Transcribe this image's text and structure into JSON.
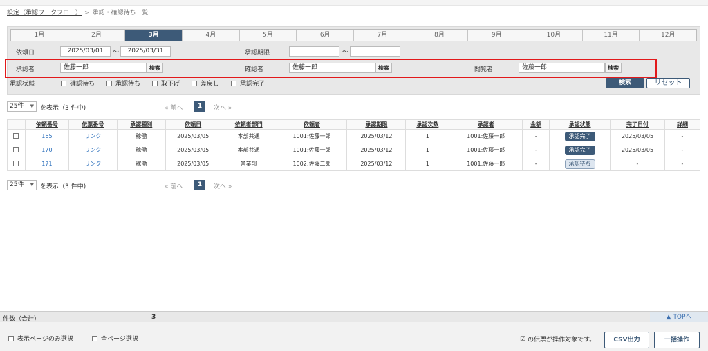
{
  "breadcrumb": {
    "root": "設定（承認ワークフロー）",
    "sep": ">",
    "current": "承認・確認待ち一覧"
  },
  "months": [
    "1月",
    "2月",
    "3月",
    "4月",
    "5月",
    "6月",
    "7月",
    "8月",
    "9月",
    "10月",
    "11月",
    "12月"
  ],
  "active_month": "3月",
  "filters": {
    "request_date_label": "依頼日",
    "request_date_from": "2025/03/01",
    "request_date_to": "2025/03/31",
    "tilde": "〜",
    "deadline_label": "承認期限",
    "deadline_from": "",
    "deadline_to": "",
    "approver_label": "承認者",
    "approver_value": "佐藤一郎",
    "confirmer_label": "確認者",
    "confirmer_value": "佐藤一郎",
    "viewer_label": "閲覧者",
    "viewer_value": "佐藤一郎",
    "lookup_label": "検索",
    "status_label": "承認状態",
    "status_options": [
      "確認待ち",
      "承認待ち",
      "取下げ",
      "差戻し",
      "承認完了"
    ],
    "search_button": "検索",
    "reset_button": "リセット"
  },
  "pager": {
    "per_page": "25件",
    "count_text": "を表示（3 件中)",
    "prev": "« 前へ",
    "page": "1",
    "next": "次へ »"
  },
  "table": {
    "headers": [
      "",
      "依頼番号",
      "伝票番号",
      "承認種別",
      "依頼日",
      "依頼者部門",
      "依頼者",
      "承認期限",
      "承認次数",
      "承認者",
      "金額",
      "承認状態",
      "完了日付",
      "詳細"
    ],
    "rows": [
      {
        "no": "165",
        "slip": "リンク",
        "type": "稼働",
        "date": "2025/03/05",
        "dept": "本部共通",
        "requester": "1001:佐藤一郎",
        "deadline": "2025/03/12",
        "level": "1",
        "approver": "1001:佐藤一郎",
        "amount": "-",
        "status": "承認完了",
        "done": "2025/03/05",
        "detail": "-"
      },
      {
        "no": "170",
        "slip": "リンク",
        "type": "稼働",
        "date": "2025/03/05",
        "dept": "本部共通",
        "requester": "1001:佐藤一郎",
        "deadline": "2025/03/12",
        "level": "1",
        "approver": "1001:佐藤一郎",
        "amount": "-",
        "status": "承認完了",
        "done": "2025/03/05",
        "detail": "-"
      },
      {
        "no": "171",
        "slip": "リンク",
        "type": "稼働",
        "date": "2025/03/05",
        "dept": "営業部",
        "requester": "1002:佐藤二郎",
        "deadline": "2025/03/12",
        "level": "1",
        "approver": "1001:佐藤一郎",
        "amount": "-",
        "status": "承認待ち",
        "done": "-",
        "detail": "-"
      }
    ]
  },
  "total": {
    "label": "件数（合計）",
    "value": "3",
    "top_link": "▲ TOPへ"
  },
  "footer": {
    "select_page": "表示ページのみ選択",
    "select_all": "全ページ選択",
    "check_mark": "☑",
    "note": "の伝票が操作対象です。",
    "csv_button": "CSV出力",
    "bulk_button": "一括操作"
  },
  "colors": {
    "accent": "#3d5a78",
    "highlight_border": "#e2191b",
    "link": "#2a6ebb"
  }
}
